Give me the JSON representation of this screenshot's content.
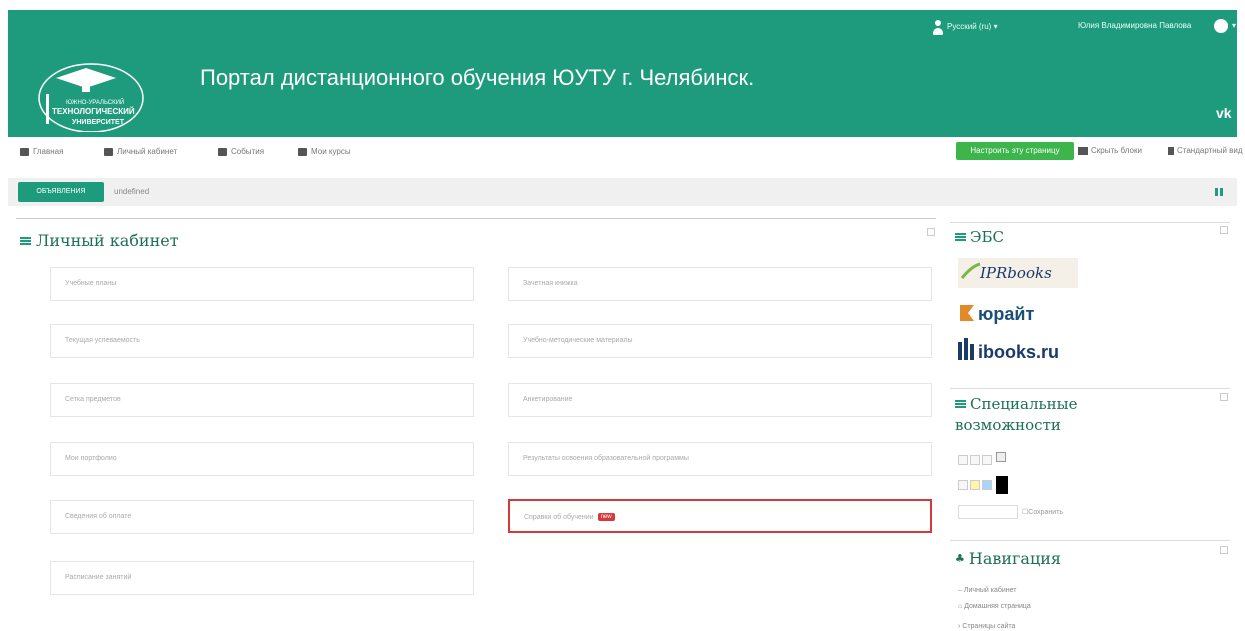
{
  "topbar": {
    "language": "Русский (ru) ▾",
    "username": "Юлия Владимировна Павлова",
    "caret": "▾"
  },
  "header": {
    "logo_text": [
      "ЮЖНО-УРАЛЬСКИЙ",
      "ТЕХНОЛОГИЧЕСКИЙ",
      "УНИВЕРСИТЕТ"
    ],
    "title": "Портал дистанционного обучения ЮУТУ г. Челябинск.",
    "vk": "vk"
  },
  "nav": {
    "items": [
      "Главная",
      "Личный кабинет",
      "События",
      "Мои курсы"
    ],
    "customize_button": "Настроить эту страницу",
    "hide_blocks": "Скрыть блоки",
    "standard_view": "Стандартный вид"
  },
  "tabs": {
    "active": "ОБЪЯВЛЕНИЯ",
    "other": "undefined"
  },
  "main": {
    "title": "Личный кабинет",
    "items_left": [
      "Учебные планы",
      "Текущая успеваемость",
      "Сетка предметов",
      "Мои портфолио",
      "Сведения об оплате",
      "Расписание занятий"
    ],
    "items_right": [
      "Зачетная книжка",
      "Учебно-методические материалы",
      "Анкетирование",
      "Результаты освоения образовательной программы",
      "Справки об обучении"
    ],
    "new_badge": "new"
  },
  "sidebar": {
    "ebs_title": "ЭБС",
    "ebs_logos": [
      "IPRbooks",
      "юрайт",
      "ibooks.ru"
    ],
    "accessibility_title_line1": "Специальные",
    "accessibility_title_line2": "возможности",
    "accessibility_save": "Сохранить",
    "navigation_title": "Навигация",
    "navigation_items": [
      "Личный кабинет",
      "Домашняя страница",
      "Страницы сайта"
    ]
  },
  "colors": {
    "brand": "#1e9b7c",
    "button_green": "#3cb54a",
    "highlight": "#d93838"
  }
}
